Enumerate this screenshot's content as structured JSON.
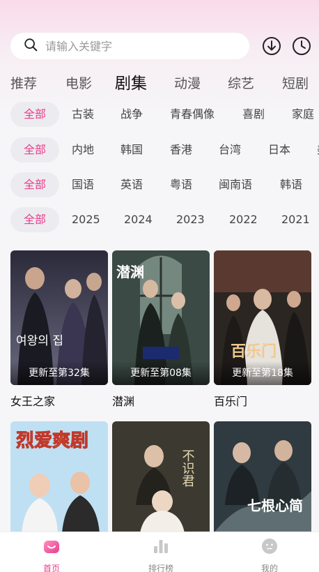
{
  "search": {
    "placeholder": "请输入关键字"
  },
  "header": {
    "download_icon": "download-circle-icon",
    "history_icon": "clock-icon"
  },
  "main_tabs": [
    "推荐",
    "电影",
    "剧集",
    "动漫",
    "综艺",
    "短剧"
  ],
  "active_main_tab": "剧集",
  "filters": {
    "genre": [
      "全部",
      "古装",
      "战争",
      "青春偶像",
      "喜剧",
      "家庭"
    ],
    "region": [
      "全部",
      "内地",
      "韩国",
      "香港",
      "台湾",
      "日本",
      "美"
    ],
    "language": [
      "全部",
      "国语",
      "英语",
      "粤语",
      "闽南语",
      "韩语"
    ],
    "year": [
      "全部",
      "2025",
      "2024",
      "2023",
      "2022",
      "2021"
    ]
  },
  "shows": [
    {
      "title": "女王之家",
      "badge": "更新至第32集",
      "poster_text": "여왕의 집"
    },
    {
      "title": "潜渊",
      "badge": "更新至第08集",
      "poster_text": "潜渊"
    },
    {
      "title": "百乐门",
      "badge": "更新至第18集",
      "poster_text": "百乐门"
    },
    {
      "title": "",
      "badge": "",
      "poster_text": "烈爱爽剧"
    },
    {
      "title": "",
      "badge": "",
      "poster_text": "不识君"
    },
    {
      "title": "",
      "badge": "",
      "poster_text": "七根心简"
    }
  ],
  "bottom_nav": [
    {
      "label": "首页",
      "icon": "home-icon"
    },
    {
      "label": "排行榜",
      "icon": "bar-chart-icon"
    },
    {
      "label": "我的",
      "icon": "user-face-icon"
    }
  ],
  "colors": {
    "accent": "#e83e8c",
    "bg": "#f6f6f8"
  }
}
